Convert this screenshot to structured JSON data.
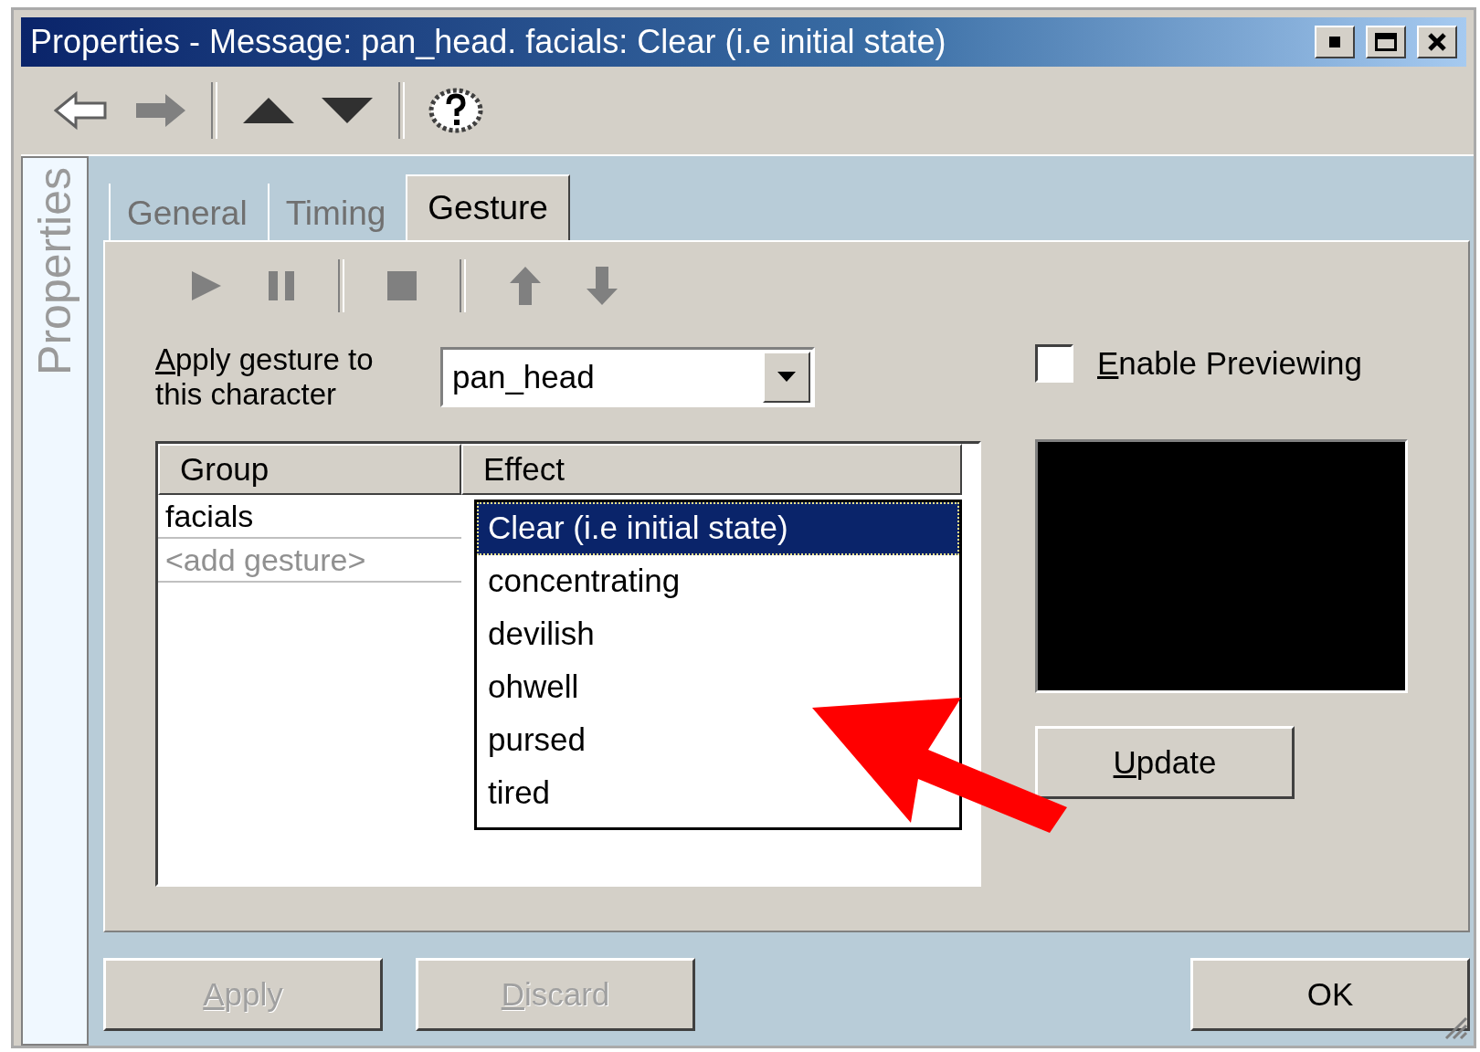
{
  "window": {
    "title": "Properties - Message: pan_head. facials: Clear (i.e initial state)"
  },
  "toolbar": [
    {
      "kind": "back"
    },
    {
      "kind": "forward"
    },
    {
      "kind": "separator"
    },
    {
      "kind": "up"
    },
    {
      "kind": "down"
    },
    {
      "kind": "separator"
    },
    {
      "kind": "help"
    }
  ],
  "sidebar": {
    "label": "Properties"
  },
  "tabs": [
    {
      "label": "General",
      "selected": false
    },
    {
      "label": "Timing",
      "selected": false
    },
    {
      "label": "Gesture",
      "selected": true
    }
  ],
  "gesture_toolbar": [
    {
      "kind": "play"
    },
    {
      "kind": "pause"
    },
    {
      "kind": "separator"
    },
    {
      "kind": "stop"
    },
    {
      "kind": "separator"
    },
    {
      "kind": "up"
    },
    {
      "kind": "down"
    }
  ],
  "apply_gesture": {
    "label": "Apply gesture to this character",
    "mnemonic": true,
    "value": "pan_head"
  },
  "enable_previewing": {
    "label": "Enable Previewing",
    "mnemonic": true,
    "checked": false
  },
  "table": {
    "columns": [
      "Group",
      "Effect"
    ],
    "rows": [
      {
        "group": "facials",
        "kind": "item"
      },
      {
        "group": "<add gesture>",
        "kind": "placeholder"
      }
    ]
  },
  "effect_dropdown": {
    "options": [
      {
        "label": "Clear (i.e initial state)",
        "selected": true
      },
      {
        "label": "concentrating",
        "selected": false
      },
      {
        "label": "devilish",
        "selected": false
      },
      {
        "label": "ohwell",
        "selected": false
      },
      {
        "label": "pursed",
        "selected": false
      },
      {
        "label": "tired",
        "selected": false
      }
    ]
  },
  "update_button": {
    "label": "Update",
    "mnemonic": true
  },
  "buttons": [
    {
      "label": "Apply",
      "mnemonic": true,
      "disabled": true
    },
    {
      "label": "Discard",
      "mnemonic": true,
      "disabled": true
    },
    {
      "label": "OK",
      "mnemonic": false,
      "disabled": false
    }
  ]
}
